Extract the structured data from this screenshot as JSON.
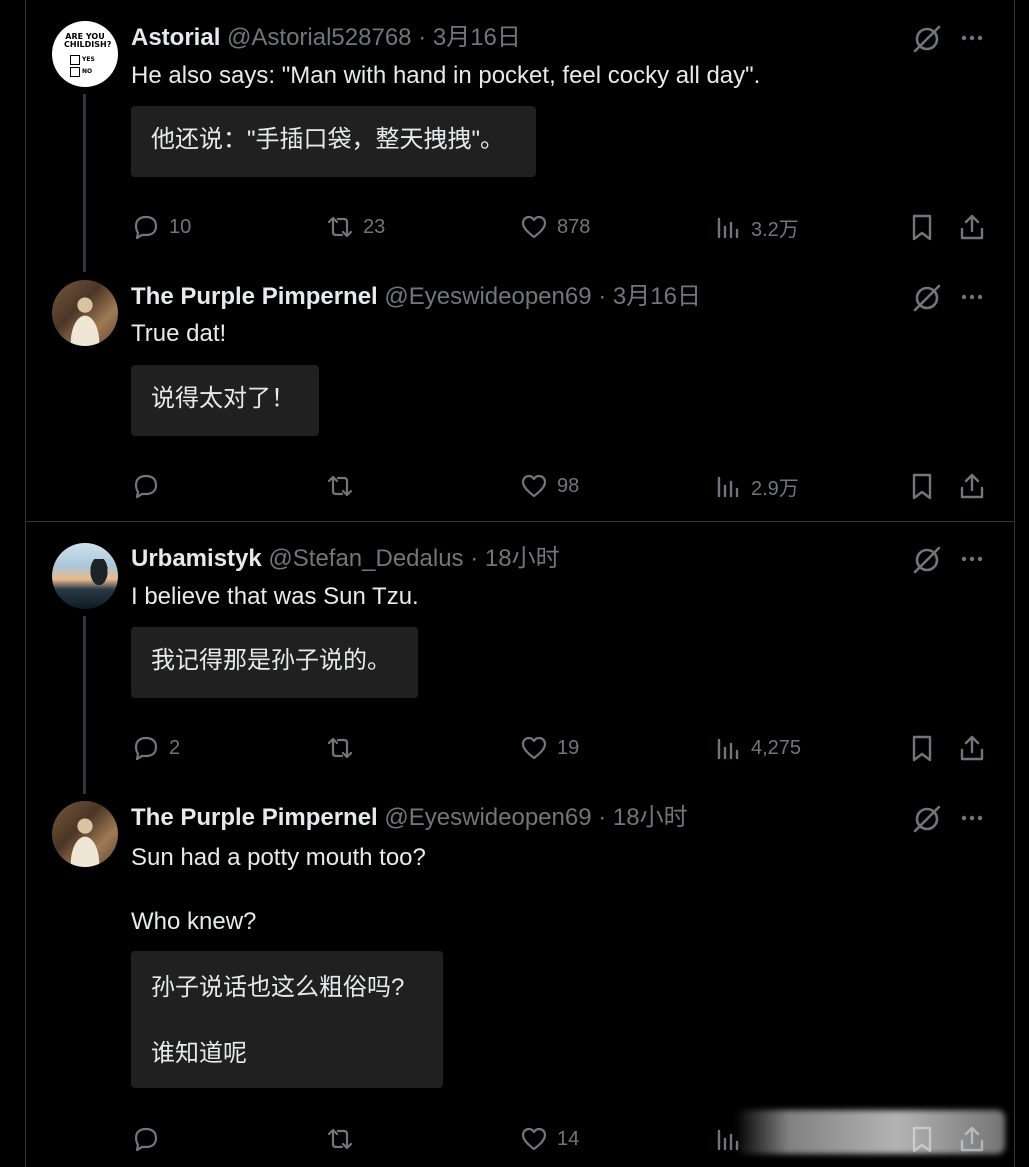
{
  "tweets": [
    {
      "name": "Astorial",
      "handle": "@Astorial528768",
      "separator": "·",
      "time": "3月16日",
      "text": "He also says: \"Man with hand in pocket, feel cocky all day\".",
      "translation": "他还说：\"手插口袋，整天拽拽\"。",
      "avatar": {
        "line1": "ARE YOU",
        "line2": "CHILDISH?",
        "yes": "YES",
        "no": "NO"
      },
      "replies": "10",
      "retweets": "23",
      "likes": "878",
      "views": "3.2万"
    },
    {
      "name": "The Purple Pimpernel",
      "handle": "@Eyeswideopen69",
      "separator": "·",
      "time": "3月16日",
      "text": "True dat!",
      "translation": "说得太对了！",
      "replies": "",
      "retweets": "",
      "likes": "98",
      "views": "2.9万"
    },
    {
      "name": "Urbamistyk",
      "handle": "@Stefan_Dedalus",
      "separator": "·",
      "time": "18小时",
      "text": "I believe that was Sun Tzu.",
      "translation": "我记得那是孙子说的。",
      "replies": "2",
      "retweets": "",
      "likes": "19",
      "views": "4,275"
    },
    {
      "name": "The Purple Pimpernel",
      "handle": "@Eyeswideopen69",
      "separator": "·",
      "time": "18小时",
      "text": "Sun had a potty mouth too?\n\nWho knew?",
      "translation": "孙子说话也这么粗俗吗?\n\n谁知道呢",
      "replies": "",
      "retweets": "",
      "likes": "14",
      "views": ""
    }
  ],
  "icons": {
    "grok": "grok-icon",
    "more": "more-icon",
    "reply": "reply-icon",
    "retweet": "retweet-icon",
    "like": "like-icon",
    "views": "views-icon",
    "bookmark": "bookmark-icon",
    "share": "share-icon"
  },
  "colors": {
    "background": "#000000",
    "text": "#e7e9ea",
    "muted": "#71767b",
    "translation_bg": "#202020",
    "divider": "#2f3336"
  }
}
